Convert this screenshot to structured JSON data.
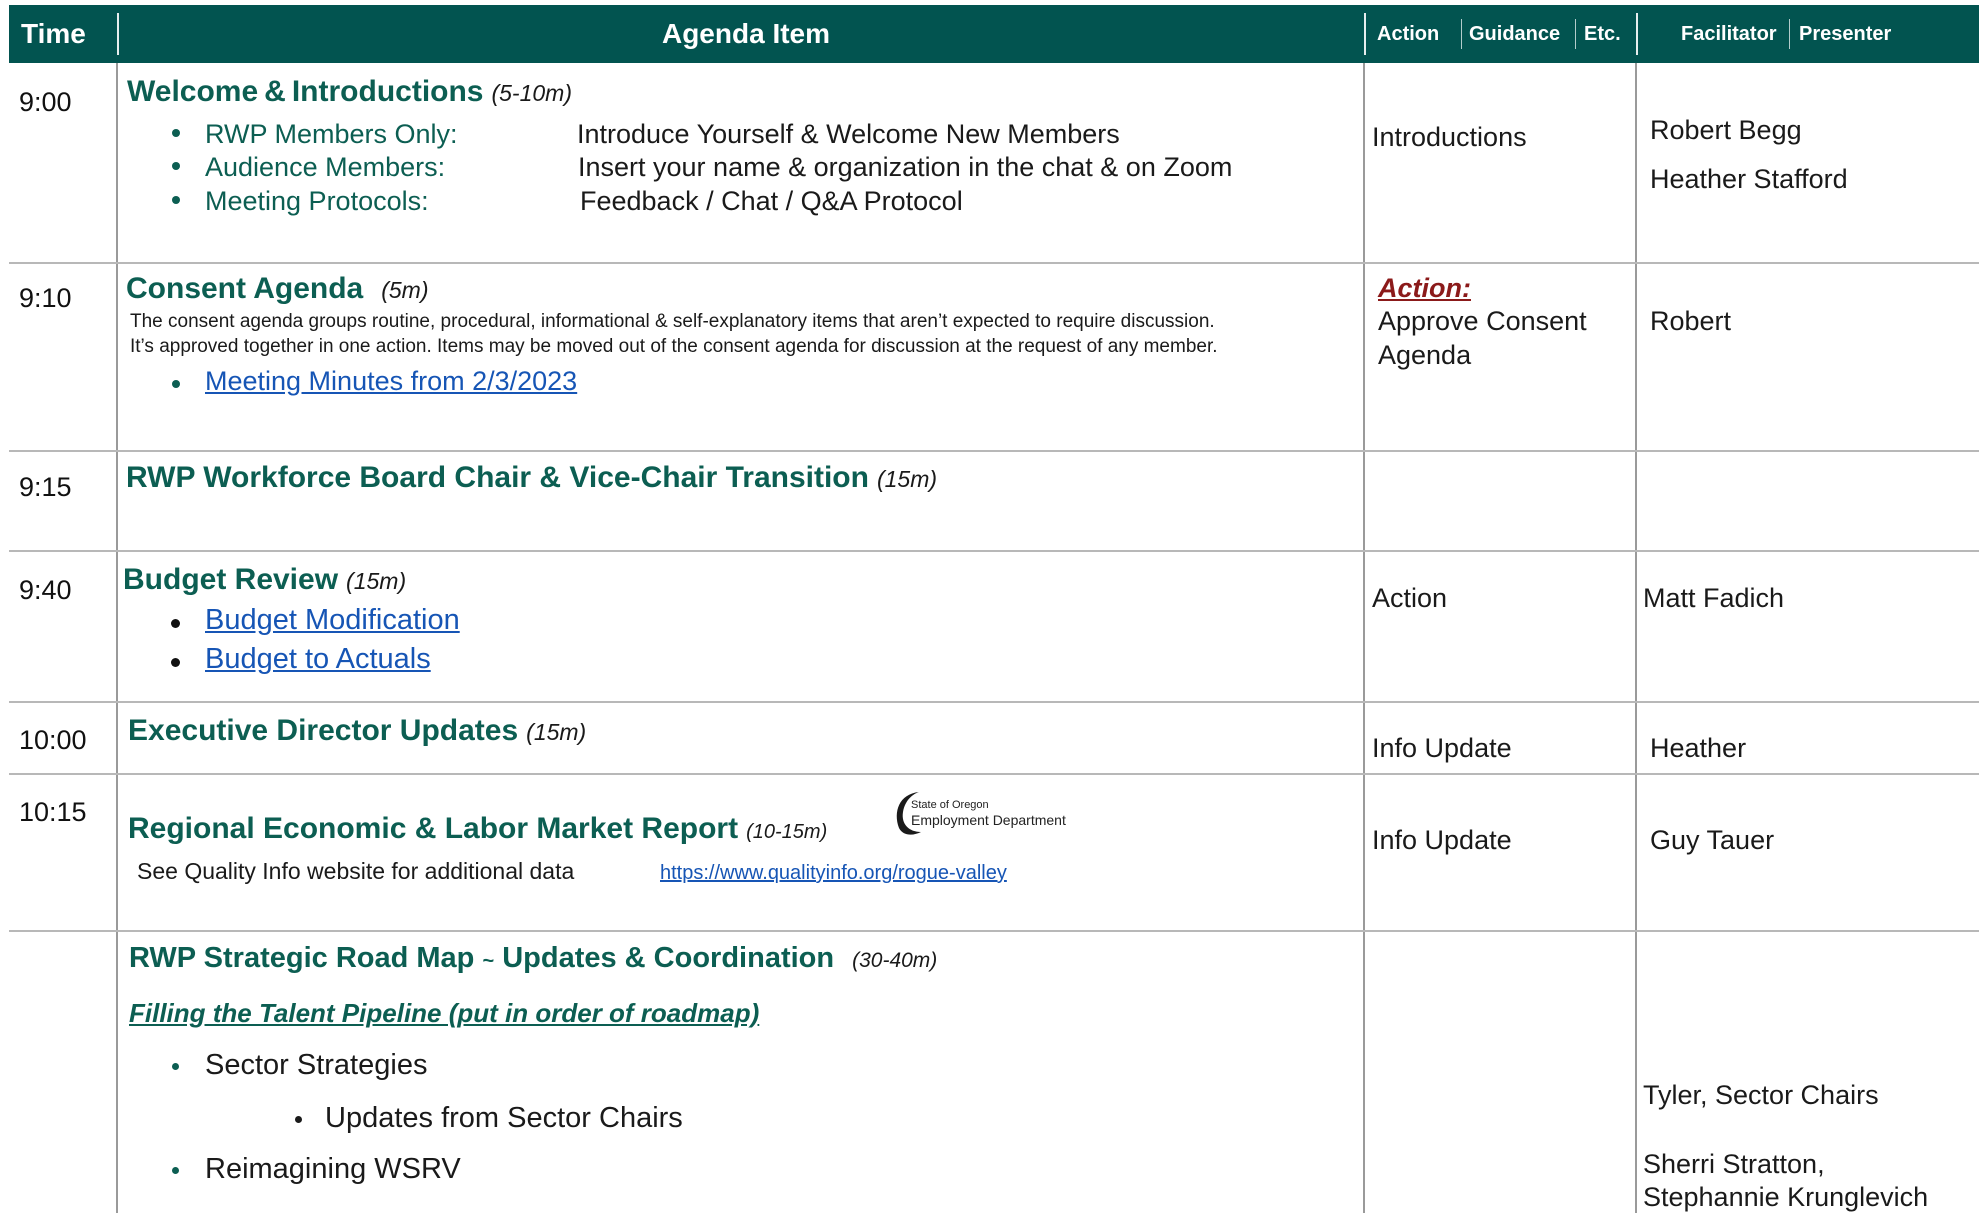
{
  "header": {
    "time": "Time",
    "agenda_item": "Agenda Item",
    "action": "Action",
    "guidance": "Guidance",
    "etc": "Etc.",
    "facilitator": "Facilitator",
    "presenter": "Presenter"
  },
  "rows": {
    "welcome": {
      "time": "9:00",
      "title": "Welcome & Introductions",
      "duration": "(5-10m)",
      "items": [
        {
          "label": "RWP Members Only:",
          "value": "Introduce Yourself & Welcome New Members"
        },
        {
          "label": "Audience Members:",
          "value": "Insert your name & organization in the chat & on Zoom"
        },
        {
          "label": "Meeting Protocols:",
          "value": "Feedback / Chat / Q&A Protocol"
        }
      ],
      "action": "Introductions",
      "presenters": [
        "Robert Begg",
        "Heather Stafford"
      ]
    },
    "consent": {
      "time": "9:10",
      "title": "Consent Agenda",
      "duration": "(5m)",
      "desc_line1": "The consent agenda groups routine, procedural, informational & self-explanatory items that aren’t expected to require discussion.",
      "desc_line2": "It’s approved together in one action. Items may be moved out of the consent agenda for discussion at the request of any member.",
      "link": "Meeting Minutes from 2/3/2023",
      "action_label": "Action:",
      "action_line1": "Approve Consent",
      "action_line2": "Agenda",
      "presenter": "Robert"
    },
    "chair": {
      "time": "9:15",
      "title": "RWP Workforce Board Chair & Vice-Chair Transition",
      "duration": "(15m)"
    },
    "budget": {
      "time": "9:40",
      "title": "Budget Review",
      "duration": "(15m)",
      "links": [
        "Budget Modification",
        "Budget to Actuals"
      ],
      "action": "Action",
      "presenter": "Matt Fadich"
    },
    "exec": {
      "time": "10:00",
      "title": "Executive Director Updates",
      "duration": "(15m)",
      "action": "Info Update",
      "presenter": "Heather"
    },
    "labor": {
      "time": "10:15",
      "title": "Regional Economic & Labor Market Report",
      "duration": "(10-15m)",
      "logo_line1": "State of Oregon",
      "logo_line2": "Employment Department",
      "note": "See Quality Info website for additional data",
      "url": "https://www.qualityinfo.org/rogue-valley",
      "action": "Info Update",
      "presenter": "Guy Tauer"
    },
    "roadmap": {
      "title_a": "RWP Strategic Road Map",
      "tilde": "~",
      "title_b": "Updates & Coordination",
      "duration": "(30-40m)",
      "subtitle": "Filling the Talent Pipeline (put in order of roadmap)",
      "items": [
        "Sector Strategies",
        "Updates from Sector Chairs",
        "Reimagining WSRV"
      ],
      "presenter1": "Tyler, Sector Chairs",
      "presenter2_line1": "Sherri Stratton,",
      "presenter2_line2": "Stephannie Krunglevich"
    }
  },
  "colors": {
    "header_bg": "#025450",
    "title_green": "#0c5e52",
    "link_blue": "#1655b5",
    "action_red": "#8b1a1a"
  }
}
